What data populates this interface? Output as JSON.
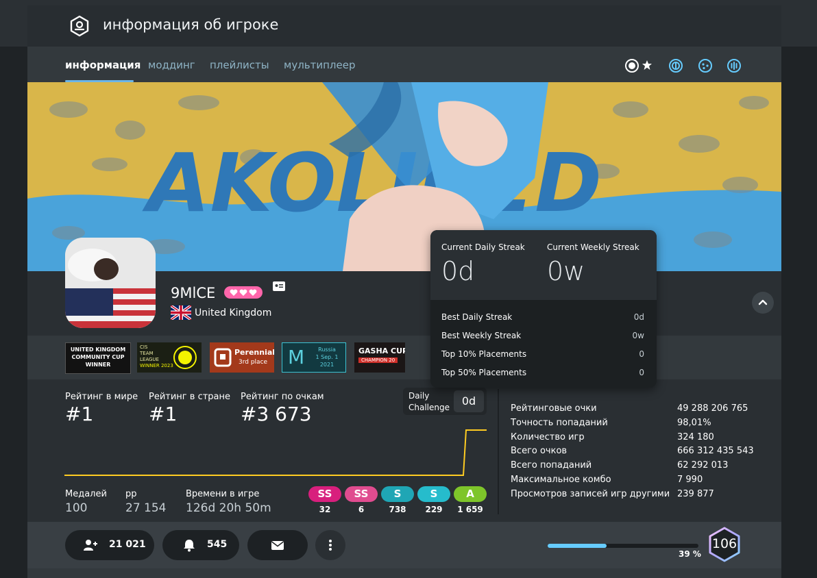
{
  "header": {
    "title": "информация об игроке"
  },
  "nav": {
    "tabs": [
      "информация",
      "моддинг",
      "плейлисты",
      "мультиплеер"
    ],
    "mode_icons": [
      "osu-standard-icon",
      "osu-taiko-icon",
      "osu-catch-icon",
      "osu-mania-icon"
    ]
  },
  "cover": {
    "text": "AKOLIBED"
  },
  "profile": {
    "username": "9MlCE",
    "country": "United Kingdom"
  },
  "badges": [
    {
      "lines": [
        "UNITED KINGDOM",
        "COMMUNITY CUP",
        "WINNER"
      ]
    },
    {
      "lines": [
        "CIS",
        "TEAM",
        "LEAGUE",
        "WINNER 2023"
      ]
    },
    {
      "lines": [
        "Perennial",
        "3rd place"
      ]
    },
    {
      "lines": [
        "M",
        "Russia",
        "1 Sep. 1",
        "2021"
      ]
    },
    {
      "lines": [
        "GASHA CUP",
        "CHAMPION 20"
      ]
    }
  ],
  "ranks": {
    "global_label": "Рейтинг в мире",
    "global": "#1",
    "country_label": "Рейтинг в стране",
    "country": "#1",
    "score_label": "Рейтинг по очкам",
    "score": "#3 673"
  },
  "daily": {
    "label_line1": "Daily",
    "label_line2": "Challenge",
    "value": "0d"
  },
  "misc": {
    "medals_label": "Медалей",
    "medals": "100",
    "pp_label": "pp",
    "pp": "27 154",
    "playtime_label": "Времени в игре",
    "playtime": "126d 20h 50m"
  },
  "grades": [
    {
      "label": "SS",
      "count": "32",
      "color": "#d81f7d"
    },
    {
      "label": "SS",
      "count": "6",
      "color": "#e04c8f"
    },
    {
      "label": "S",
      "count": "738",
      "color": "#1fa6b5"
    },
    {
      "label": "S",
      "count": "229",
      "color": "#26bccc"
    },
    {
      "label": "A",
      "count": "1 659",
      "color": "#7ec52a"
    }
  ],
  "stats": [
    {
      "label": "Рейтинговые очки",
      "value": "49 288 206 765"
    },
    {
      "label": "Точность попаданий",
      "value": "98,01%"
    },
    {
      "label": "Количество игр",
      "value": "324 180"
    },
    {
      "label": "Всего очков",
      "value": "666 312 435 543"
    },
    {
      "label": "Всего попаданий",
      "value": "62 292 013"
    },
    {
      "label": "Максимальное комбо",
      "value": "7 990"
    },
    {
      "label": "Просмотров записей игр другими",
      "value": "239 877"
    }
  ],
  "footer": {
    "followers": "21 021",
    "mapping_subs": "545",
    "level_progress_pct": 39,
    "level_progress_label": "39 %",
    "level": "106"
  },
  "popup": {
    "daily_streak_label": "Current Daily Streak",
    "daily_streak": "0d",
    "weekly_streak_label": "Current Weekly Streak",
    "weekly_streak": "0w",
    "rows": [
      {
        "label": "Best Daily Streak",
        "value": "0d"
      },
      {
        "label": "Best Weekly Streak",
        "value": "0w"
      },
      {
        "label": "Top 10% Placements",
        "value": "0"
      },
      {
        "label": "Top 50% Placements",
        "value": "0"
      }
    ]
  },
  "colors": {
    "accent": "#66ccff",
    "supporter": "#ff66ab",
    "graph": "#ffcc22"
  }
}
